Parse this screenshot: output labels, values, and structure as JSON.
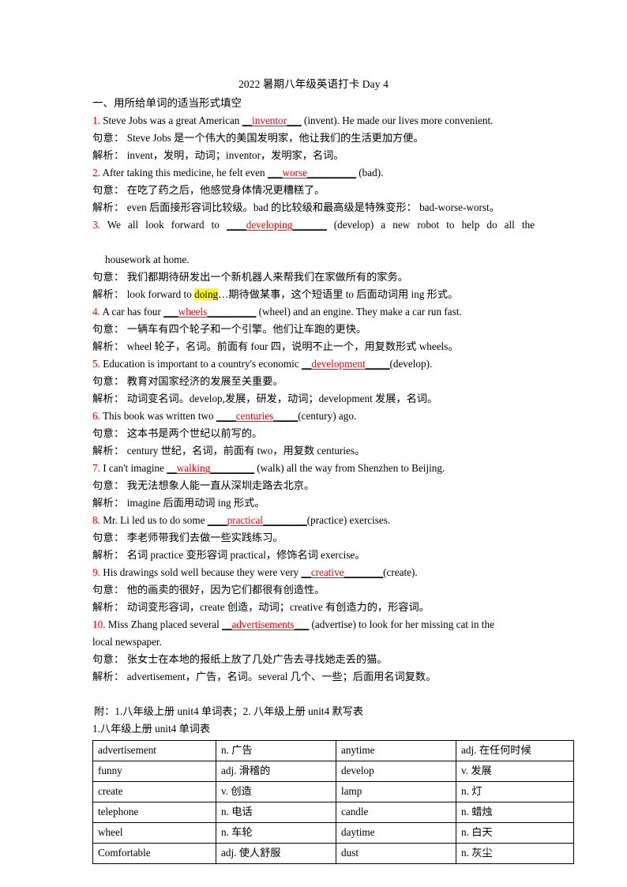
{
  "document": {
    "title": "2022 暑期八年级英语打卡 Day 4",
    "section_heading": "一、用所给单词的适当形式填空"
  },
  "questions": [
    {
      "num": "1.",
      "stem_before": " Steve Jobs was a great American ",
      "blank_lead": "__",
      "answer": "inventor",
      "blank_trail": "___",
      "stem_after": " (invent). He made our lives more convenient.",
      "continuation": "",
      "meaning_label": "句意：",
      "meaning": " Steve Jobs 是一个伟大的美国发明家，他让我们的生活更加方便。",
      "analysis_label": "解析：",
      "analysis": " invent，发明，动词；inventor，发明家，名词。",
      "justified": false
    },
    {
      "num": "2.",
      "stem_before": " After taking this medicine, he felt even ",
      "blank_lead": "___",
      "answer": "worse",
      "blank_trail": "__________",
      "stem_after": " (bad).",
      "continuation": "",
      "meaning_label": "句意：",
      "meaning": " 在吃了药之后，他感觉身体情况更糟糕了。",
      "analysis_label": "解析：",
      "analysis": " even 后面接形容词比较级。bad 的比较级和最高级是特殊变形： bad-worse-worst。",
      "justified": false
    },
    {
      "num": "3.",
      "stem_before": " We all look forward to ",
      "blank_lead": "____",
      "answer": "developing",
      "blank_trail": "_______",
      "stem_after": " (develop) a new robot to help do all the",
      "continuation": "housework at home.",
      "meaning_label": "句意：",
      "meaning": " 我们都期待研发出一个新机器人来帮我们在家做所有的家务。",
      "analysis_label": "解析：",
      "analysis_pre": " look forward to ",
      "analysis_hl": "doing",
      "analysis_post": "…期待做某事，这个短语里 to 后面动词用 ing 形式。",
      "justified": true
    },
    {
      "num": "4.",
      "stem_before": " A car has four ",
      "blank_lead": "___",
      "answer": "wheels",
      "blank_trail": "__________",
      "stem_after": " (wheel) and an engine. They make a car run fast.",
      "continuation": "",
      "meaning_label": "句意：",
      "meaning": " 一辆车有四个轮子和一个引擎。他们让车跑的更快。",
      "analysis_label": "解析：",
      "analysis": " wheel 轮子，名词。前面有 four 四，说明不止一个，用复数形式 wheels。",
      "justified": false
    },
    {
      "num": "5.",
      "stem_before": " Education is important to a country's economic ",
      "blank_lead": "__",
      "answer": "development",
      "blank_trail": "_____",
      "stem_after": "(develop).",
      "continuation": "",
      "meaning_label": "句意：",
      "meaning": " 教育对国家经济的发展至关重要。",
      "analysis_label": "解析：",
      "analysis": " 动词变名词。develop,发展，研发，动词；development 发展，名词。",
      "justified": false
    },
    {
      "num": "6.",
      "stem_before": " This book was written two ",
      "blank_lead": "____",
      "answer": "centuries",
      "blank_trail": "_____",
      "stem_after": "(century) ago.",
      "continuation": "",
      "meaning_label": "句意：",
      "meaning": " 这本书是两个世纪以前写的。",
      "analysis_label": "解析：",
      "analysis": " century 世纪，名词，前面有 two，用复数 centuries。",
      "justified": false
    },
    {
      "num": "7.",
      "stem_before": " I can't imagine ",
      "blank_lead": "__",
      "answer": "walking",
      "blank_trail": "_________",
      "stem_after": " (walk) all the way from Shenzhen to Beijing.",
      "continuation": "",
      "meaning_label": "句意：",
      "meaning": " 我无法想象人能一直从深圳走路去北京。",
      "analysis_label": "解析：",
      "analysis": " imagine 后面用动词 ing 形式。",
      "justified": false
    },
    {
      "num": "8.",
      "stem_before": " Mr. Li led us to do some ",
      "blank_lead": "____",
      "answer": "practical",
      "blank_trail": "_________",
      "stem_after": "(practice) exercises.",
      "continuation": "",
      "meaning_label": "句意：",
      "meaning": " 李老师带我们去做一些实践练习。",
      "analysis_label": "解析：",
      "analysis": " 名词 practice 变形容词 practical，修饰名词 exercise。",
      "justified": false
    },
    {
      "num": "9.",
      "stem_before": " His drawings sold well because they were very ",
      "blank_lead": "__",
      "answer": "creative",
      "blank_trail": "________",
      "stem_after": "(create).",
      "continuation": "",
      "meaning_label": "句意：",
      "meaning": " 他的画卖的很好，因为它们都很有创造性。",
      "analysis_label": "解析：",
      "analysis": " 动词变形容词，create 创造，动词；creative 有创造力的，形容词。",
      "justified": false
    },
    {
      "num": "10.",
      "stem_before": " Miss Zhang placed several ",
      "blank_lead": "__",
      "answer": "advertisements",
      "blank_trail": "___",
      "stem_after": " (advertise) to look for her missing cat in the",
      "continuation": "local newspaper.",
      "meaning_label": "句意：",
      "meaning": " 张女士在本地的报纸上放了几处广告去寻找她走丢的猫。",
      "analysis_label": "解析：",
      "analysis": " advertisement，广告，名词。several 几个、一些；后面用名词复数。",
      "justified": false
    }
  ],
  "appendix": {
    "line1": "附：1.八年级上册 unit4 单词表；2. 八年级上册 unit4 默写表",
    "line2": "1.八年级上册 unit4 单词表"
  },
  "vocab_table": {
    "rows": [
      [
        "advertisement",
        "n. 广告",
        "anytime",
        "adj. 在任何时候"
      ],
      [
        "funny",
        "adj. 滑稽的",
        "develop",
        "v. 发展"
      ],
      [
        "create",
        "v. 创造",
        "lamp",
        "n. 灯"
      ],
      [
        "telephone",
        "n. 电话",
        "candle",
        "n. 蜡烛"
      ],
      [
        "wheel",
        "n. 车轮",
        "daytime",
        "n. 白天"
      ],
      [
        "Comfortable",
        "adj. 使人舒服",
        "dust",
        "n. 灰尘"
      ]
    ]
  },
  "colors": {
    "answer_red": "#ff0000",
    "highlight_yellow": "#ffff00",
    "text_black": "#000000"
  }
}
